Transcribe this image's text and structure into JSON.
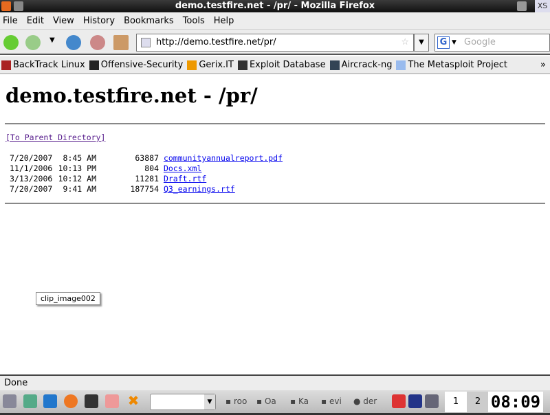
{
  "window": {
    "title": "demo.testfire.net - /pr/ - Mozilla Firefox",
    "corner_label": "XS"
  },
  "menu": [
    "File",
    "Edit",
    "View",
    "History",
    "Bookmarks",
    "Tools",
    "Help"
  ],
  "nav": {
    "url": "http://demo.testfire.net/pr/",
    "search_placeholder": "Google",
    "dropdown_glyph": "▼"
  },
  "bookmarks": [
    "BackTrack Linux",
    "Offensive-Security",
    "Gerix.IT",
    "Exploit Database",
    "Aircrack-ng",
    "The Metasploit Project"
  ],
  "bookmarks_overflow": "»",
  "page": {
    "heading": "demo.testfire.net - /pr/",
    "parent_link": "[To Parent Directory]",
    "files": [
      {
        "date": "7/20/2007",
        "time": "8:45 AM",
        "size": "63887",
        "name": "communityannualreport.pdf"
      },
      {
        "date": "11/1/2006",
        "time": "10:13 PM",
        "size": "804",
        "name": "Docs.xml"
      },
      {
        "date": "3/13/2006",
        "time": "10:12 AM",
        "size": "11281",
        "name": "Draft.rtf"
      },
      {
        "date": "7/20/2007",
        "time": "9:41 AM",
        "size": "187754",
        "name": "Q3_earnings.rtf"
      }
    ]
  },
  "tooltip": "clip_image002",
  "status": "Done",
  "taskbar": {
    "tasks": [
      "roo",
      "Oa",
      "Ka",
      "evi",
      "der"
    ],
    "workspaces": [
      "1",
      "2"
    ],
    "clock": "08:09"
  },
  "colors": {
    "link": "#0000ee",
    "visited": "#551a8b"
  }
}
